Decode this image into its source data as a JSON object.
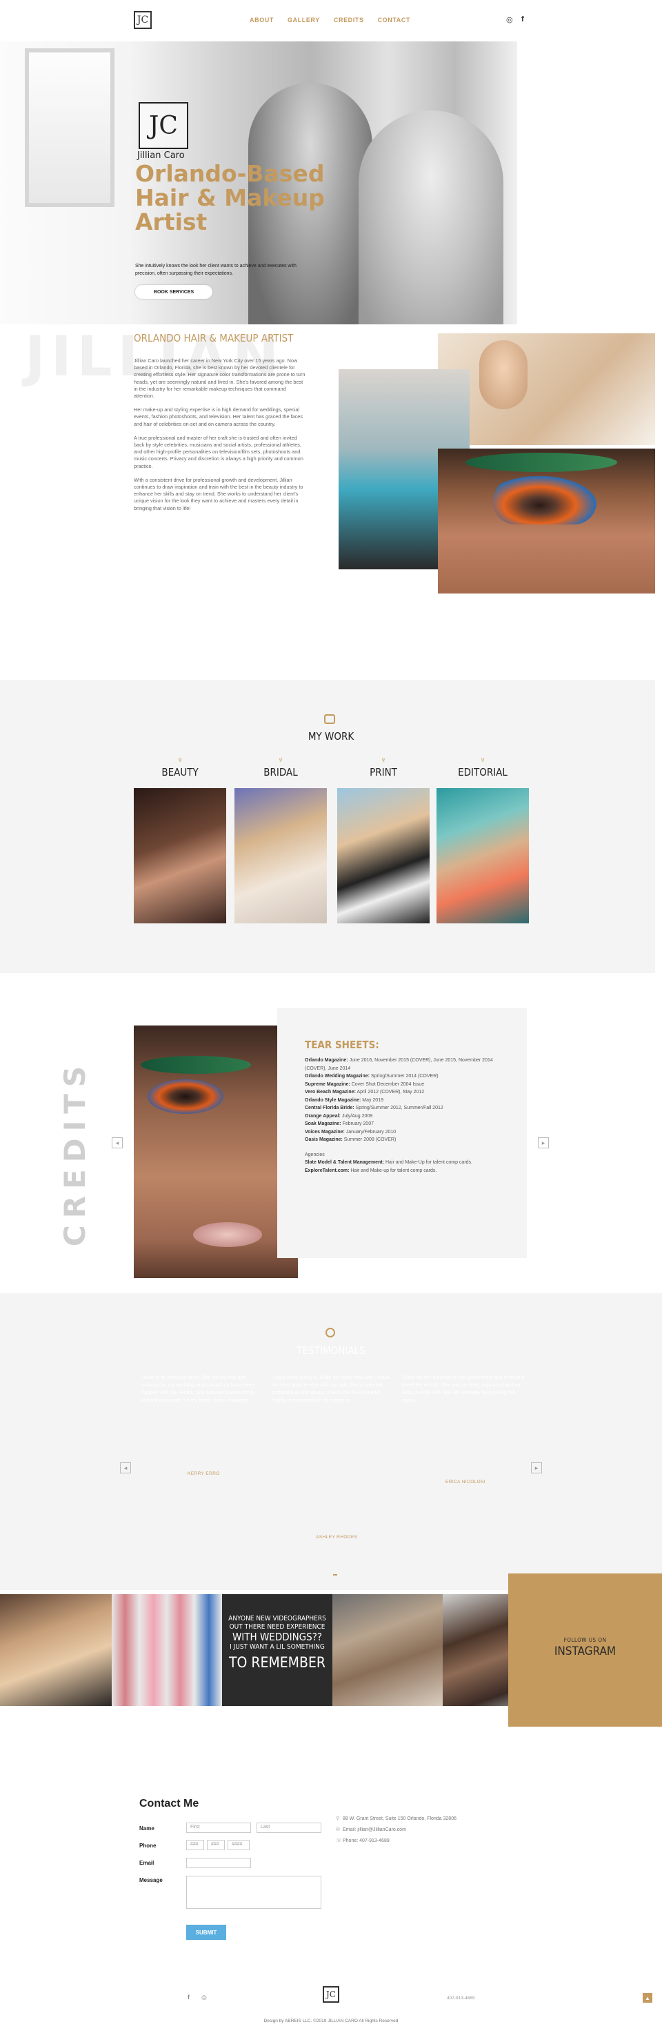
{
  "header": {
    "logo_text": "JC",
    "nav": [
      "ABOUT",
      "GALLERY",
      "CREDITS",
      "CONTACT"
    ],
    "social": {
      "instagram_icon": "◎",
      "facebook_icon": "f"
    }
  },
  "hero": {
    "logo_text": "JC",
    "name": "Jillian Caro",
    "title": "Orlando-Based Hair & Makeup Artist",
    "subtitle": "She intuitively knows the look her client wants to achieve and executes with precision, often surpassing their expectations.",
    "button": "BOOK SERVICES"
  },
  "about": {
    "ghost_text": "JILLIAN",
    "heading": "ORLANDO HAIR & MAKEUP ARTIST",
    "paragraphs": [
      "Jillian Caro launched her career in New York City over 15 years ago. Now based in Orlando, Florida, she is best known by her devoted clientele for creating effortless style. Her signature color transformations are prone to turn heads, yet are seemingly natural and lived in. She's favored among the best in the industry for her remarkable makeup techniques that command attention.",
      "Her make-up and styling expertise is in high demand for weddings, special events, fashion photoshoots, and television. Her talent has graced the faces and hair of celebrities on-set and on camera across the country.",
      "A true professional and master of her craft she is trusted and often invited back by style celebrities, musicians and social artists, professional athletes, and other high-profile personalities on television/film sets, photoshoots and music concerts. Privacy and discretion is always a high priority and common practice.",
      "With a consistent drive for professional growth and development, Jillian continues to draw inspiration and train with the best in the beauty industry to enhance her skills and stay on trend. She works to understand her client's unique vision for the look they want to achieve and masters every detail in bringing that vision to life!"
    ]
  },
  "work": {
    "heading": "MY WORK",
    "categories": [
      "BEAUTY",
      "BRIDAL",
      "PRINT",
      "EDITORIAL"
    ]
  },
  "credits": {
    "ghost_text": "CREDITS",
    "heading": "TEAR SHEETS:",
    "lines": [
      {
        "b": "Orlando Magazine:",
        "t": " June 2016, November 2015 (COVER), June 2015, November 2014 (COVER), June 2014"
      },
      {
        "b": "Orlando Wedding Magazine:",
        "t": " Spring/Summer 2014 (COVER)"
      },
      {
        "b": "Supreme Magazine:",
        "t": " Cover Shot December 2004 Issue"
      },
      {
        "b": "Vero Beach Magazine:",
        "t": " April 2012 (COVER), May 2012"
      },
      {
        "b": "Orlando Style Magazine:",
        "t": " May 2019"
      },
      {
        "b": "Central Florida Bride:",
        "t": " Spring/Summer 2012, Summer/Fall 2012"
      },
      {
        "b": "Orange Appeal:",
        "t": " July/Aug 2009"
      },
      {
        "b": "Soak Magazine:",
        "t": " February 2007"
      },
      {
        "b": "Voices Magazine:",
        "t": " January/February 2010"
      },
      {
        "b": "Oasis Magazine:",
        "t": " Summer 2008 (COVER)"
      }
    ],
    "agencies_label": "Agencies",
    "agencies": [
      {
        "b": "Slate Model & Talent Management:",
        "t": " Hair and Make-Up for talent comp cards."
      },
      {
        "b": "ExploreTalent.com:",
        "t": " Hair and Make-up for talent comp cards."
      }
    ],
    "arrow_left": "◂",
    "arrow_right": "▸"
  },
  "testimonials": {
    "heading": "TESTIMONIALS",
    "quotes": [
      "Jillian is an amazing artist. She did my hair and makeup for my wedding and I could not have been happier with the results. She listened to everything I wanted and made it even better than I imagined.",
      "I have been going to Jillian for years now and I would not trust anyone else with my hair. She is talented, professional and always makes me feel beautiful. Highly recommend her to everyone.",
      "Jillian did the makeup for our photoshoot and everyone loved the results. She was on time, organized and so easy to work with. We will definitely be booking her again."
    ],
    "names": [
      "KERRY ERRO",
      "ERICA NICOLOSI",
      "ASHLEY RHODES"
    ],
    "arrow_left": "◂",
    "arrow_right": "▸"
  },
  "instagram": {
    "text_a": "ANYONE NEW VIDEOGRAPHERS",
    "text_b": "OUT THERE NEED EXPERIENCE",
    "text_c": "WITH WEDDINGS??",
    "text_d": "I JUST WANT A LIL SOMETHING",
    "text_e": "TO REMEMBER",
    "follow_small": "FOLLOW US ON",
    "follow_large": "INSTAGRAM"
  },
  "contact": {
    "heading": "Contact Me",
    "name_label": "Name",
    "first_placeholder": "First",
    "last_placeholder": "Last",
    "phone_label": "Phone",
    "phone_ph1": "###",
    "phone_ph2": "###",
    "phone_ph3": "####",
    "email_label": "Email",
    "message_label": "Message",
    "submit": "SUBMIT",
    "address": "88 W. Grant Street, Suite 150 Orlando, Florida 32806",
    "email": "Email: jillian@JillianCaro.com",
    "phone": "Phone: 407-913-4689",
    "pin_icon": "⚲",
    "mail_icon": "✉",
    "phone_icon": "☏"
  },
  "footer": {
    "logo_text": "JC",
    "phone": "407-913-4689",
    "copyright": "Design by ABREIS LLC. ©2019 JILLIAN CARO All Rights Reserved",
    "to_top": "▲",
    "facebook_icon": "f",
    "instagram_icon": "◎"
  },
  "colors": {
    "accent": "#c49a5e",
    "dark": "#2b2b2b",
    "panel": "#f4f4f4",
    "submit": "#5aaee0"
  }
}
